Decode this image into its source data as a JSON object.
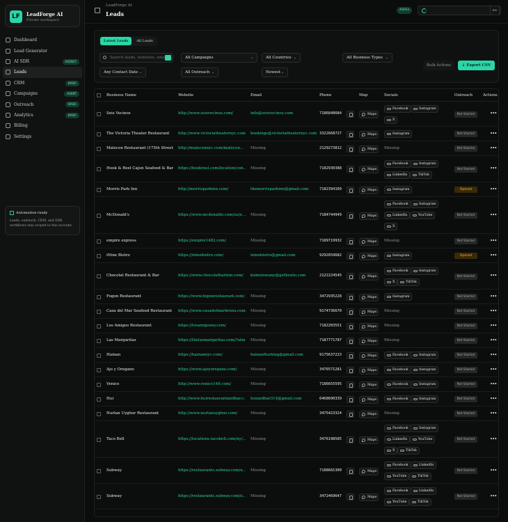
{
  "brand": {
    "name": "LeadForge AI",
    "subtitle": "Private workspace",
    "logo_glyph": "LF"
  },
  "nav": [
    {
      "label": "Dashboard",
      "icon": "dashboard-icon",
      "badge": ""
    },
    {
      "label": "Lead Generator",
      "icon": "sparkle-icon",
      "badge": ""
    },
    {
      "label": "AI SDR",
      "icon": "bot-icon",
      "badge": "AGENCY"
    },
    {
      "label": "Leads",
      "icon": "users-icon",
      "badge": "",
      "active": true
    },
    {
      "label": "CRM",
      "icon": "crm-icon",
      "badge": "BASIC"
    },
    {
      "label": "Campaigns",
      "icon": "megaphone-icon",
      "badge": "AGENT"
    },
    {
      "label": "Outreach",
      "icon": "mail-icon",
      "badge": "BASIC"
    },
    {
      "label": "Analytics",
      "icon": "chart-icon",
      "badge": "BASIC"
    },
    {
      "label": "Billing",
      "icon": "card-icon",
      "badge": ""
    },
    {
      "label": "Settings",
      "icon": "gear-icon",
      "badge": ""
    }
  ],
  "automation": {
    "title": "Automation ready",
    "desc": "Leads, outreach, CRM, and SDR workflows stay scoped to this account."
  },
  "header": {
    "breadcrumb": "LeadForge AI",
    "title": "Leads",
    "admin_badge": "Admin",
    "logout_glyph": "↦"
  },
  "filters": {
    "tabs": [
      "Latest Leads",
      "All Leads"
    ],
    "search_placeholder": "Search leads, websites, emails...",
    "campaigns": "All Campaigns",
    "countries": "All Countries",
    "business_types": "All Business Types",
    "contact_date": "Any Contact Date",
    "outreach": "All Outreach",
    "sort": "Newest",
    "bulk": "Bulk Actions",
    "export": "Export CSV"
  },
  "table": {
    "columns": [
      "Business Name",
      "Website",
      "Email",
      "Phone",
      "Map",
      "Socials",
      "Outreach",
      "Actions"
    ],
    "map_label": "Maps",
    "missing": "Missing",
    "rows": [
      {
        "name": "Seis Vecinos",
        "web": "http://www.seisvecinos.com/",
        "email": "info@seisvecinos.com",
        "phone": "7186848684",
        "socials": [
          "Facebook",
          "Instagram",
          "X"
        ],
        "status": "Not Started"
      },
      {
        "name": "The Victoria Theater Restaurant",
        "web": "http://www.victoriatheaternyc.com/",
        "email": "bookings@victoriatheaternyc.com",
        "phone": "3322668727",
        "socials": [
          "Instagram"
        ],
        "status": "Not Started"
      },
      {
        "name": "Malecon Restaurant (175th Street)",
        "web": "http://maleconnyc.com/malecon...",
        "email": "",
        "phone": "2129273812",
        "socials": [],
        "status": "Not Started"
      },
      {
        "name": "Hook & Reel Cajun Seafood & Bar",
        "web": "https://hookreel.com/location/con...",
        "email": "",
        "phone": "7182930388",
        "socials": [
          "Facebook",
          "Instagram",
          "LinkedIn",
          "TikTok"
        ],
        "status": "Not Started"
      },
      {
        "name": "Morris Park Inn",
        "web": "http://morrisparkinn.com/",
        "email": "themorrisparkinn@gmail.com",
        "phone": "7182394109",
        "socials": [
          "Instagram"
        ],
        "status": "Opened"
      },
      {
        "name": "McDonald's",
        "web": "https://www.mcdonalds.com/us/e...",
        "email": "",
        "phone": "7184744949",
        "socials": [
          "Facebook",
          "Instagram",
          "LinkedIn",
          "YouTube",
          "X"
        ],
        "status": "Not Started"
      },
      {
        "name": "empire express",
        "web": "https://empire1482.com/",
        "email": "",
        "phone": "7189719932",
        "socials": [],
        "status": "Not Started"
      },
      {
        "name": "iNine Bistro",
        "web": "https://ininebistro.com/",
        "email": "ininebistro@gmail.com",
        "phone": "9292659682",
        "socials": [
          "Instagram"
        ],
        "status": "Opened"
      },
      {
        "name": "Chocolat Restaurant & Bar",
        "web": "https://www.chocolatharlem.com/",
        "email": "ksimslowany@gethento.com",
        "phone": "2122224545",
        "socials": [
          "Facebook",
          "Instagram",
          "X",
          "TikTok"
        ],
        "status": "Not Started"
      },
      {
        "name": "Fogon Restaurant",
        "web": "https://www.fogonrestaurant.com/",
        "email": "",
        "phone": "3472935228",
        "socials": [
          "Instagram"
        ],
        "status": "Not Started"
      },
      {
        "name": "Casa del Mar Seafood Restaurant",
        "web": "https://www.casadelmarbronx.com/",
        "email": "",
        "phone": "9174736670",
        "socials": [],
        "status": "Not Started"
      },
      {
        "name": "Los Amigos Restaurant",
        "web": "https://losamigosny.com/",
        "email": "",
        "phone": "7182203551",
        "socials": [],
        "status": "Not Started"
      },
      {
        "name": "Las Margaritas",
        "web": "https://thelasmargaritas.com/?utm...",
        "email": "",
        "phone": "7187771787",
        "socials": [],
        "status": "Not Started"
      },
      {
        "name": "Hainan",
        "web": "https://hainannyc.com/",
        "email": "hainanflushing@gmail.com",
        "phone": "9175637223",
        "socials": [
          "Facebook",
          "Instagram"
        ],
        "status": "Not Started"
      },
      {
        "name": "Ajo y Oregano",
        "web": "https://www.ajoyoregano.com/",
        "email": "",
        "phone": "3476571281",
        "socials": [
          "Facebook",
          "Instagram"
        ],
        "status": "Not Started"
      },
      {
        "name": "Venice",
        "web": "http://www.venice149.com/",
        "email": "",
        "phone": "7186655595",
        "socials": [
          "Facebook",
          "Instagram"
        ],
        "status": "Not Started"
      },
      {
        "name": "Hui",
        "web": "http://www.huirestaurantandbar.c...",
        "email": "huiandbar314@gmail.com",
        "phone": "6468690339",
        "socials": [
          "Facebook",
          "Instagram"
        ],
        "status": "Not Started"
      },
      {
        "name": "Nurlan Uyghur Restaurant",
        "web": "http://www.nurlanuyghur.com/",
        "email": "",
        "phone": "3475423324",
        "socials": [],
        "status": "Not Started"
      },
      {
        "name": "Taco Bell",
        "web": "https://locations.tacobell.com/ny/...",
        "email": "",
        "phone": "3476198585",
        "socials": [
          "Facebook",
          "Instagram",
          "LinkedIn",
          "YouTube",
          "X",
          "TikTok"
        ],
        "status": "Not Started"
      },
      {
        "name": "Subway",
        "web": "https://restaurants.subway.com/u...",
        "email": "",
        "phone": "7188681300",
        "socials": [
          "Facebook",
          "LinkedIn",
          "YouTube",
          "TikTok"
        ],
        "status": "Not Started"
      },
      {
        "name": "Subway",
        "web": "https://restaurants.subway.com/u...",
        "email": "",
        "phone": "3472469647",
        "socials": [
          "Facebook",
          "LinkedIn",
          "YouTube",
          "TikTok"
        ],
        "status": "Not Started"
      }
    ]
  },
  "colors": {
    "accent": "#2bd6a6",
    "opened": "#f0b63a",
    "background": "#0b0d0c"
  }
}
